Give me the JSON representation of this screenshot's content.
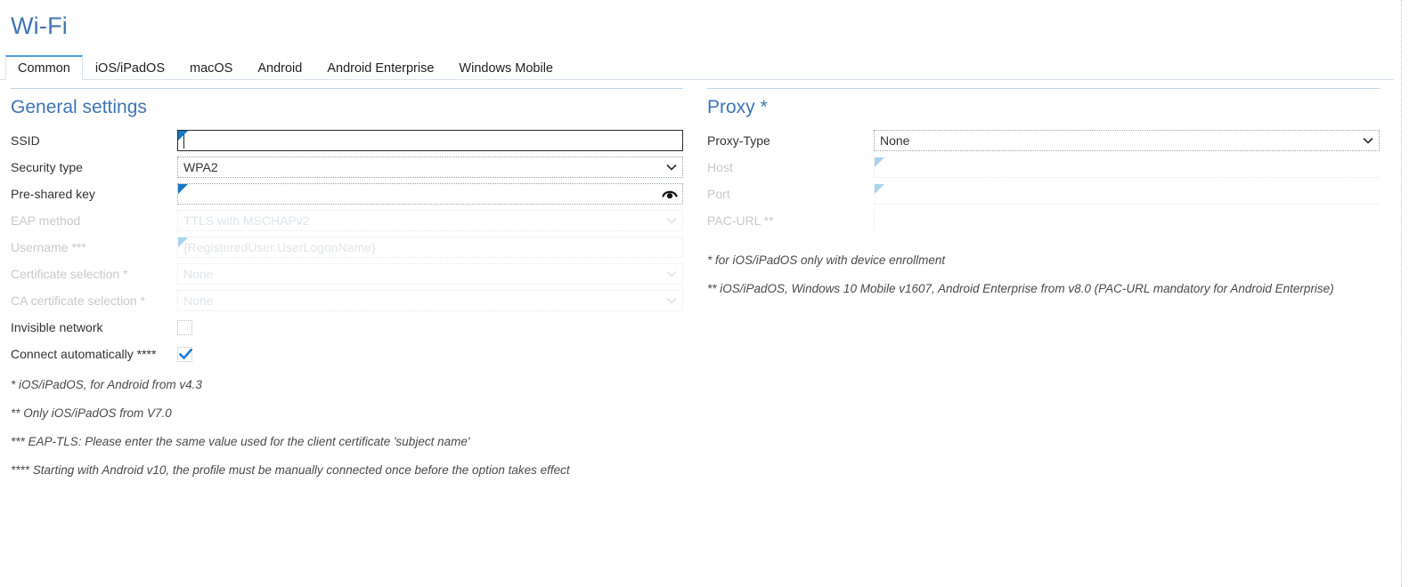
{
  "header": {
    "title": "Wi-Fi"
  },
  "tabs": [
    {
      "label": "Common",
      "active": true
    },
    {
      "label": "iOS/iPadOS",
      "active": false
    },
    {
      "label": "macOS",
      "active": false
    },
    {
      "label": "Android",
      "active": false
    },
    {
      "label": "Android Enterprise",
      "active": false
    },
    {
      "label": "Windows Mobile",
      "active": false
    }
  ],
  "general": {
    "section_title": "General settings",
    "fields": {
      "ssid": {
        "label": "SSID",
        "value": "",
        "state": "focused",
        "required": true
      },
      "security_type": {
        "label": "Security type",
        "value": "WPA2",
        "state": "enabled",
        "options": [
          "WPA2"
        ]
      },
      "pre_shared_key": {
        "label": "Pre-shared key",
        "value": "",
        "state": "enabled",
        "required": true,
        "reveal_icon": "eye-icon"
      },
      "eap_method": {
        "label": "EAP method",
        "value": "TTLS with MSCHAPv2",
        "state": "disabled"
      },
      "username": {
        "label": "Username ***",
        "value": "{RegisteredUser.UserLogonName}",
        "state": "disabled",
        "required": true
      },
      "certificate_selection": {
        "label": "Certificate selection *",
        "value": "None",
        "state": "disabled"
      },
      "ca_certificate_selection": {
        "label": "CA certificate selection *",
        "value": "None",
        "state": "disabled"
      },
      "invisible_network": {
        "label": "Invisible network",
        "checked": false,
        "state": "enabled"
      },
      "connect_automatically": {
        "label": "Connect automatically ****",
        "checked": true,
        "state": "enabled"
      }
    },
    "notes": [
      "* iOS/iPadOS, for Android from v4.3",
      "** Only iOS/iPadOS from V7.0",
      "*** EAP-TLS: Please enter the same value used for the client certificate 'subject name'",
      "**** Starting with Android v10, the profile must be manually connected once before the option takes effect"
    ]
  },
  "proxy": {
    "section_title": "Proxy *",
    "fields": {
      "proxy_type": {
        "label": "Proxy-Type",
        "value": "None",
        "state": "enabled",
        "options": [
          "None"
        ]
      },
      "host": {
        "label": "Host",
        "value": "",
        "state": "disabled",
        "required": true
      },
      "port": {
        "label": "Port",
        "value": "",
        "state": "disabled",
        "required": true
      },
      "pac_url": {
        "label": "PAC-URL **",
        "value": "",
        "state": "disabled"
      }
    },
    "notes": [
      "* for iOS/iPadOS only with device enrollment",
      "** iOS/iPadOS, Windows 10 Mobile v1607, Android Enterprise from v8.0 (PAC-URL mandatory for Android Enterprise)"
    ]
  },
  "colors": {
    "accent_blue": "#3f75b5",
    "tab_active_top": "#4a9fd8",
    "required_marker": "#1877c4",
    "required_marker_disabled": "#a9d4f0",
    "section_rule": "#bfd7e8",
    "disabled_text": "#c9c9c9"
  }
}
